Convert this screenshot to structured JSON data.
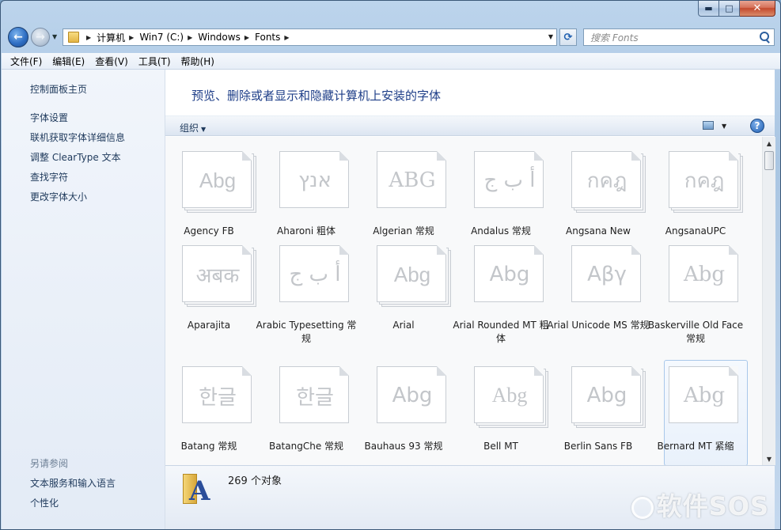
{
  "window": {
    "minimize_glyph": "▬",
    "maximize_glyph": "□",
    "close_glyph": "✕"
  },
  "nav": {
    "back_glyph": "←",
    "forward_glyph": "→",
    "breadcrumbs": [
      "计算机",
      "Win7 (C:)",
      "Windows",
      "Fonts"
    ],
    "refresh_glyph": "⟳",
    "search_placeholder": "搜索 Fonts"
  },
  "menu": [
    "文件(F)",
    "编辑(E)",
    "查看(V)",
    "工具(T)",
    "帮助(H)"
  ],
  "sidebar": {
    "links": [
      "控制面板主页",
      "字体设置",
      "联机获取字体详细信息",
      "调整 ClearType 文本",
      "查找字符",
      "更改字体大小"
    ],
    "see_also_heading": "另请参阅",
    "see_also": [
      "文本服务和输入语言",
      "个性化"
    ]
  },
  "main": {
    "title": "预览、删除或者显示和隐藏计算机上安装的字体",
    "organize_label": "组织",
    "help_glyph": "?"
  },
  "fonts": [
    {
      "name": "Agency FB",
      "sample": "Abg",
      "family": "Liberation Sans Narrow",
      "stacked": true
    },
    {
      "name": "Aharoni 粗体",
      "sample": "אנץ",
      "family": "DejaVu Sans",
      "stacked": false
    },
    {
      "name": "Algerian 常规",
      "sample": "ABG",
      "family": "DejaVu Serif",
      "stacked": false
    },
    {
      "name": "Andalus 常规",
      "sample": "أ ب ج",
      "family": "DejaVu Sans",
      "stacked": false
    },
    {
      "name": "Angsana New",
      "sample": "กคฎ",
      "family": "DejaVu Sans",
      "stacked": true
    },
    {
      "name": "AngsanaUPC",
      "sample": "กคฎ",
      "family": "DejaVu Sans",
      "stacked": true
    },
    {
      "name": "Aparajita",
      "sample": "अबक",
      "family": "DejaVu Serif",
      "stacked": true
    },
    {
      "name": "Arabic Typesetting 常规",
      "sample": "أ ب ج",
      "family": "DejaVu Serif",
      "stacked": false
    },
    {
      "name": "Arial",
      "sample": "Abg",
      "family": "Liberation Sans",
      "stacked": true
    },
    {
      "name": "Arial Rounded MT 粗体",
      "sample": "Abg",
      "family": "DejaVu Sans",
      "stacked": false
    },
    {
      "name": "Arial Unicode MS 常规",
      "sample": "Αβγ",
      "family": "DejaVu Sans",
      "stacked": false
    },
    {
      "name": "Baskerville Old Face 常规",
      "sample": "Abg",
      "family": "DejaVu Serif",
      "stacked": false
    },
    {
      "name": "Batang 常规",
      "sample": "한글",
      "family": "DejaVu Sans",
      "stacked": false
    },
    {
      "name": "BatangChe 常规",
      "sample": "한글",
      "family": "DejaVu Sans",
      "stacked": false
    },
    {
      "name": "Bauhaus 93 常规",
      "sample": "Abg",
      "family": "DejaVu Sans",
      "stacked": false
    },
    {
      "name": "Bell MT",
      "sample": "Abg",
      "family": "Liberation Serif",
      "stacked": true
    },
    {
      "name": "Berlin Sans FB",
      "sample": "Abg",
      "family": "DejaVu Sans",
      "stacked": true
    },
    {
      "name": "Bernard MT 紧缩",
      "sample": "Abg",
      "family": "DejaVu Serif",
      "stacked": false,
      "selected": true
    }
  ],
  "status": {
    "count_text": "269 个对象"
  },
  "watermark": "软件SOS"
}
